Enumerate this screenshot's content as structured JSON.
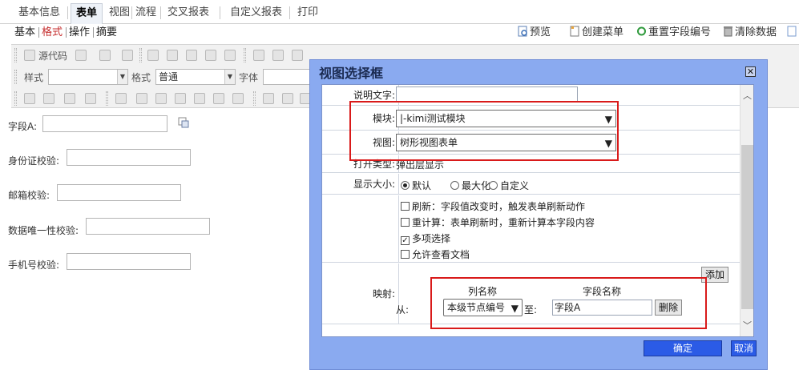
{
  "tabs": [
    "基本信息",
    "表单",
    "视图",
    "流程",
    "交叉报表",
    "自定义报表",
    "打印"
  ],
  "subtabs": [
    "基本",
    "格式",
    "操作",
    "摘要"
  ],
  "actions": [
    "预览",
    "创建菜单",
    "重置字段编号",
    "清除数据"
  ],
  "toolbar": {
    "source_code": "源代码",
    "style_label": "样式",
    "format_label": "格式",
    "format_value": "普通",
    "font_label": "字体"
  },
  "fields": [
    {
      "label": "字段A:"
    },
    {
      "label": "身份证校验:"
    },
    {
      "label": "邮箱校验:"
    },
    {
      "label": "数据唯一性校验:"
    },
    {
      "label": "手机号校验:"
    }
  ],
  "dialog": {
    "title": "视图选择框",
    "close_glyph": "✕",
    "desc_label": "说明文字:",
    "module_label": "模块:",
    "module_value": "|-kimi测试模块",
    "view_label": "视图:",
    "view_value": "树形视图表单",
    "open_type_label": "打开类型:",
    "open_type_value": "弹出层显示",
    "size_label": "显示大小:",
    "size_options": [
      "默认",
      "最大化",
      "自定义"
    ],
    "options": [
      {
        "label": "刷新：字段值改变时，触发表单刷新动作",
        "checked": false
      },
      {
        "label": "重计算：表单刷新时，重新计算本字段内容",
        "checked": false
      },
      {
        "label": "多项选择",
        "checked": true
      },
      {
        "label": "允许查看文档",
        "checked": false
      }
    ],
    "mapping_label": "映射:",
    "add_button": "添加",
    "col_header": "列名称",
    "field_header": "字段名称",
    "from_label": "从:",
    "to_label": "至:",
    "column_value": "本级节点编号",
    "field_value": "字段A",
    "delete_button": "删除",
    "ok_button": "确定",
    "cancel_button": "取消"
  },
  "colors": {
    "dialog_bg": "#8aaaf0",
    "highlight": "#d91a1a",
    "primary_button": "#2b5be6"
  }
}
